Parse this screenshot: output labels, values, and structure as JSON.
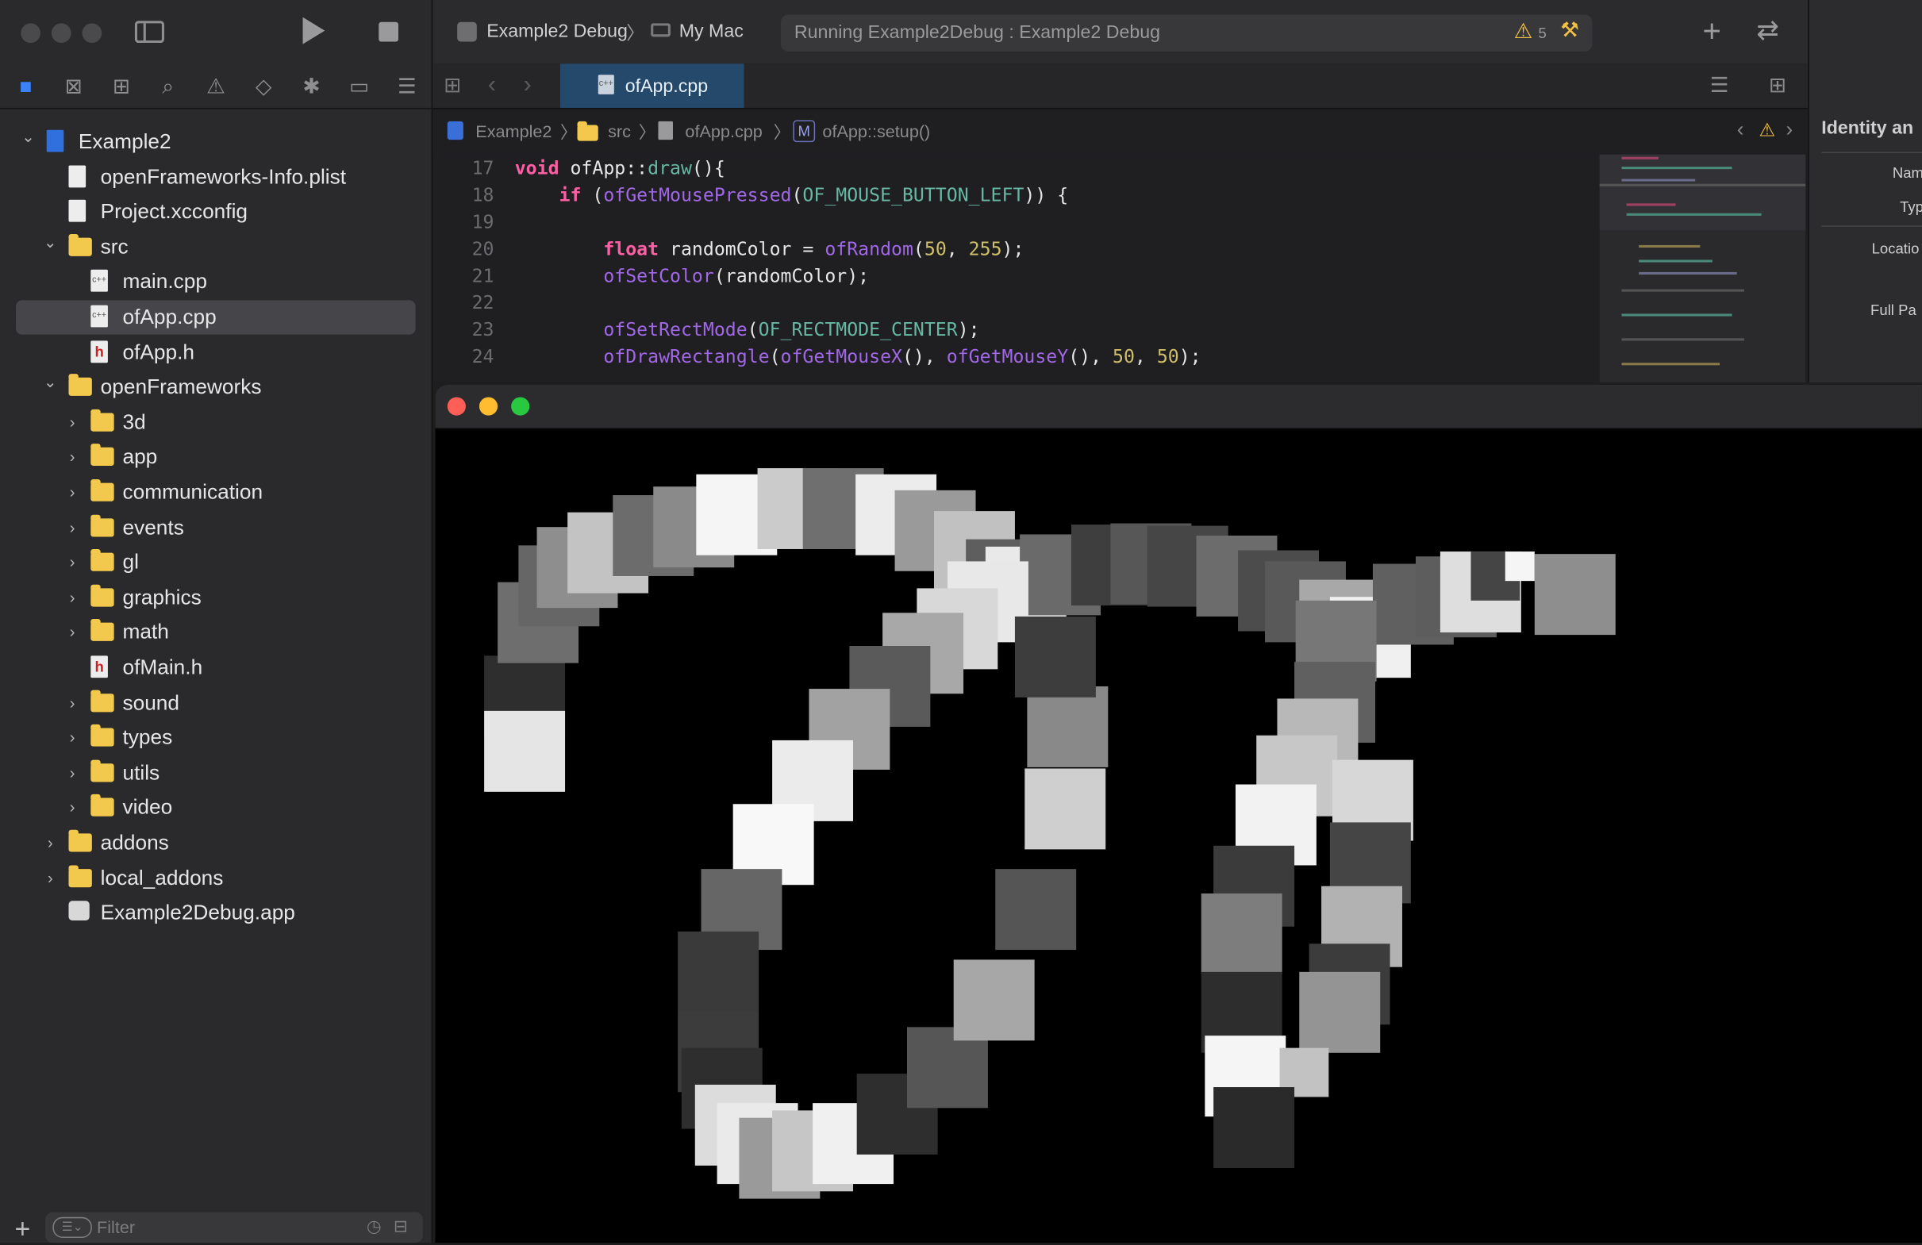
{
  "toolbar": {
    "scheme": "Example2 Debug",
    "destination": "My Mac",
    "status": "Running Example2Debug : Example2 Debug",
    "warning_count": "5"
  },
  "tab": {
    "label": "ofApp.cpp"
  },
  "jump_bar": [
    "Example2",
    "src",
    "ofApp.cpp",
    "ofApp::setup()"
  ],
  "jump_bar_symbol_badge": "M",
  "inspector": {
    "title": "Identity an",
    "labels": [
      "Nam",
      "Typ",
      "Locatio",
      "Full Pa"
    ]
  },
  "navigator": {
    "items": [
      {
        "label": "Example2",
        "kind": "project",
        "indent": 0,
        "disclosure": "open"
      },
      {
        "label": "openFrameworks-Info.plist",
        "kind": "plist",
        "indent": 1
      },
      {
        "label": "Project.xcconfig",
        "kind": "file",
        "indent": 1
      },
      {
        "label": "src",
        "kind": "folder",
        "indent": 1,
        "disclosure": "open"
      },
      {
        "label": "main.cpp",
        "kind": "cpp",
        "indent": 2
      },
      {
        "label": "ofApp.cpp",
        "kind": "cpp",
        "indent": 2,
        "selected": true
      },
      {
        "label": "ofApp.h",
        "kind": "h",
        "indent": 2
      },
      {
        "label": "openFrameworks",
        "kind": "folder",
        "indent": 1,
        "disclosure": "open"
      },
      {
        "label": "3d",
        "kind": "folder",
        "indent": 2,
        "disclosure": "closed"
      },
      {
        "label": "app",
        "kind": "folder",
        "indent": 2,
        "disclosure": "closed"
      },
      {
        "label": "communication",
        "kind": "folder",
        "indent": 2,
        "disclosure": "closed"
      },
      {
        "label": "events",
        "kind": "folder",
        "indent": 2,
        "disclosure": "closed"
      },
      {
        "label": "gl",
        "kind": "folder",
        "indent": 2,
        "disclosure": "closed"
      },
      {
        "label": "graphics",
        "kind": "folder",
        "indent": 2,
        "disclosure": "closed"
      },
      {
        "label": "math",
        "kind": "folder",
        "indent": 2,
        "disclosure": "closed"
      },
      {
        "label": "ofMain.h",
        "kind": "h",
        "indent": 2
      },
      {
        "label": "sound",
        "kind": "folder",
        "indent": 2,
        "disclosure": "closed"
      },
      {
        "label": "types",
        "kind": "folder",
        "indent": 2,
        "disclosure": "closed"
      },
      {
        "label": "utils",
        "kind": "folder",
        "indent": 2,
        "disclosure": "closed"
      },
      {
        "label": "video",
        "kind": "folder",
        "indent": 2,
        "disclosure": "closed"
      },
      {
        "label": "addons",
        "kind": "folder",
        "indent": 1,
        "disclosure": "closed"
      },
      {
        "label": "local_addons",
        "kind": "folder",
        "indent": 1,
        "disclosure": "closed"
      },
      {
        "label": "Example2Debug.app",
        "kind": "app",
        "indent": 1
      }
    ]
  },
  "filter": {
    "placeholder": "Filter"
  },
  "code": {
    "lines": [
      {
        "n": "17",
        "html": "<span class=\"kw\">void</span> ofApp::<span class=\"fn\">draw</span>(){"
      },
      {
        "n": "18",
        "html": "    <span class=\"kw\">if</span> (<span class=\"tfn\">ofGetMousePressed</span>(<span class=\"fn\">OF_MOUSE_BUTTON_LEFT</span>)) {"
      },
      {
        "n": "19",
        "html": ""
      },
      {
        "n": "20",
        "html": "        <span class=\"kw\">float</span> randomColor = <span class=\"tfn\">ofRandom</span>(<span class=\"num\">50</span>, <span class=\"num\">255</span>);"
      },
      {
        "n": "21",
        "html": "        <span class=\"tfn\">ofSetColor</span>(randomColor);"
      },
      {
        "n": "22",
        "html": ""
      },
      {
        "n": "23",
        "html": "        <span class=\"tfn\">ofSetRectMode</span>(<span class=\"fn\">OF_RECTMODE_CENTER</span>);"
      },
      {
        "n": "24",
        "html": "        <span class=\"tfn\">ofDrawRectangle</span>(<span class=\"tfn\">ofGetMouseX</span>(), <span class=\"tfn\">ofGetMouseY</span>(), <span class=\"num\">50</span>, <span class=\"num\">50</span>);"
      }
    ]
  },
  "canvas_squares": [
    [
      395,
      535,
      66,
      "#2e2e2e"
    ],
    [
      395,
      580,
      66,
      "#e5e5e5"
    ],
    [
      406,
      475,
      66,
      "#6e6e6e"
    ],
    [
      423,
      445,
      66,
      "#666"
    ],
    [
      438,
      430,
      66,
      "#8e8e8e"
    ],
    [
      463,
      418,
      66,
      "#c3c3c3"
    ],
    [
      500,
      404,
      66,
      "#6c6c6c"
    ],
    [
      533,
      397,
      66,
      "#8a8a8a"
    ],
    [
      568,
      387,
      66,
      "#f5f5f5"
    ],
    [
      618,
      382,
      66,
      "#cbcbcb"
    ],
    [
      655,
      382,
      66,
      "#6f6f6f"
    ],
    [
      698,
      387,
      66,
      "#ececec"
    ],
    [
      730,
      400,
      66,
      "#9a9a9a"
    ],
    [
      762,
      417,
      66,
      "#c1c1c1"
    ],
    [
      788,
      440,
      66,
      "#5e5e5e"
    ],
    [
      804,
      446,
      66,
      "#e9e9e9"
    ],
    [
      832,
      436,
      66,
      "#6a6a6a"
    ],
    [
      874,
      428,
      66,
      "#3e3e3e"
    ],
    [
      906,
      427,
      66,
      "#575757"
    ],
    [
      936,
      429,
      66,
      "#464646"
    ],
    [
      976,
      437,
      66,
      "#6c6c6c"
    ],
    [
      1010,
      449,
      66,
      "#4c4c4c"
    ],
    [
      1032,
      458,
      66,
      "#595959"
    ],
    [
      1060,
      473,
      66,
      "#a8a8a8"
    ],
    [
      1085,
      487,
      66,
      "#f0f0f0"
    ],
    [
      1120,
      460,
      66,
      "#606060"
    ],
    [
      1155,
      454,
      66,
      "#5d5d5d"
    ],
    [
      1175,
      450,
      66,
      "#dedede"
    ],
    [
      1200,
      450,
      40,
      "#454545"
    ],
    [
      1228,
      450,
      24,
      "#f5f5f5"
    ],
    [
      1252,
      452,
      66,
      "#8e8e8e"
    ],
    [
      773,
      458,
      66,
      "#e8e8e8"
    ],
    [
      748,
      480,
      66,
      "#d8d8d8"
    ],
    [
      720,
      500,
      66,
      "#a8a8a8"
    ],
    [
      693,
      527,
      66,
      "#5a5a5a"
    ],
    [
      660,
      562,
      66,
      "#a2a2a2"
    ],
    [
      630,
      604,
      66,
      "#ebebeb"
    ],
    [
      598,
      656,
      66,
      "#f8f8f8"
    ],
    [
      572,
      709,
      66,
      "#666"
    ],
    [
      553,
      760,
      66,
      "#3a3a3a"
    ],
    [
      553,
      825,
      66,
      "#3c3c3c"
    ],
    [
      556,
      855,
      66,
      "#2e2e2e"
    ],
    [
      567,
      885,
      66,
      "#dcdcdc"
    ],
    [
      585,
      900,
      66,
      "#eaeaea"
    ],
    [
      603,
      912,
      66,
      "#9a9a9a"
    ],
    [
      630,
      906,
      66,
      "#c6c6c6"
    ],
    [
      663,
      900,
      66,
      "#f0f0f0"
    ],
    [
      699,
      876,
      66,
      "#2e2e2e"
    ],
    [
      740,
      838,
      66,
      "#565656"
    ],
    [
      778,
      783,
      66,
      "#a7a7a7"
    ],
    [
      812,
      709,
      66,
      "#555"
    ],
    [
      836,
      627,
      66,
      "#cfcfcf"
    ],
    [
      838,
      560,
      66,
      "#898989"
    ],
    [
      828,
      503,
      66,
      "#3d3d3d"
    ],
    [
      1057,
      490,
      66,
      "#777"
    ],
    [
      1056,
      540,
      66,
      "#606060"
    ],
    [
      1042,
      570,
      66,
      "#b8b8b8"
    ],
    [
      1025,
      600,
      66,
      "#c7c7c7"
    ],
    [
      1087,
      620,
      66,
      "#d7d7d7"
    ],
    [
      1008,
      640,
      66,
      "#f2f2f2"
    ],
    [
      990,
      690,
      66,
      "#3b3b3b"
    ],
    [
      1085,
      671,
      66,
      "#454545"
    ],
    [
      1078,
      723,
      66,
      "#b2b2b2"
    ],
    [
      980,
      729,
      66,
      "#7d7d7d"
    ],
    [
      1068,
      770,
      66,
      "#3c3c3c"
    ],
    [
      980,
      793,
      66,
      "#2d2d2d"
    ],
    [
      1060,
      793,
      66,
      "#949494"
    ],
    [
      983,
      845,
      66,
      "#f5f5f5"
    ],
    [
      1044,
      855,
      40,
      "#c2c2c2"
    ],
    [
      990,
      887,
      66,
      "#2a2a2a"
    ]
  ]
}
